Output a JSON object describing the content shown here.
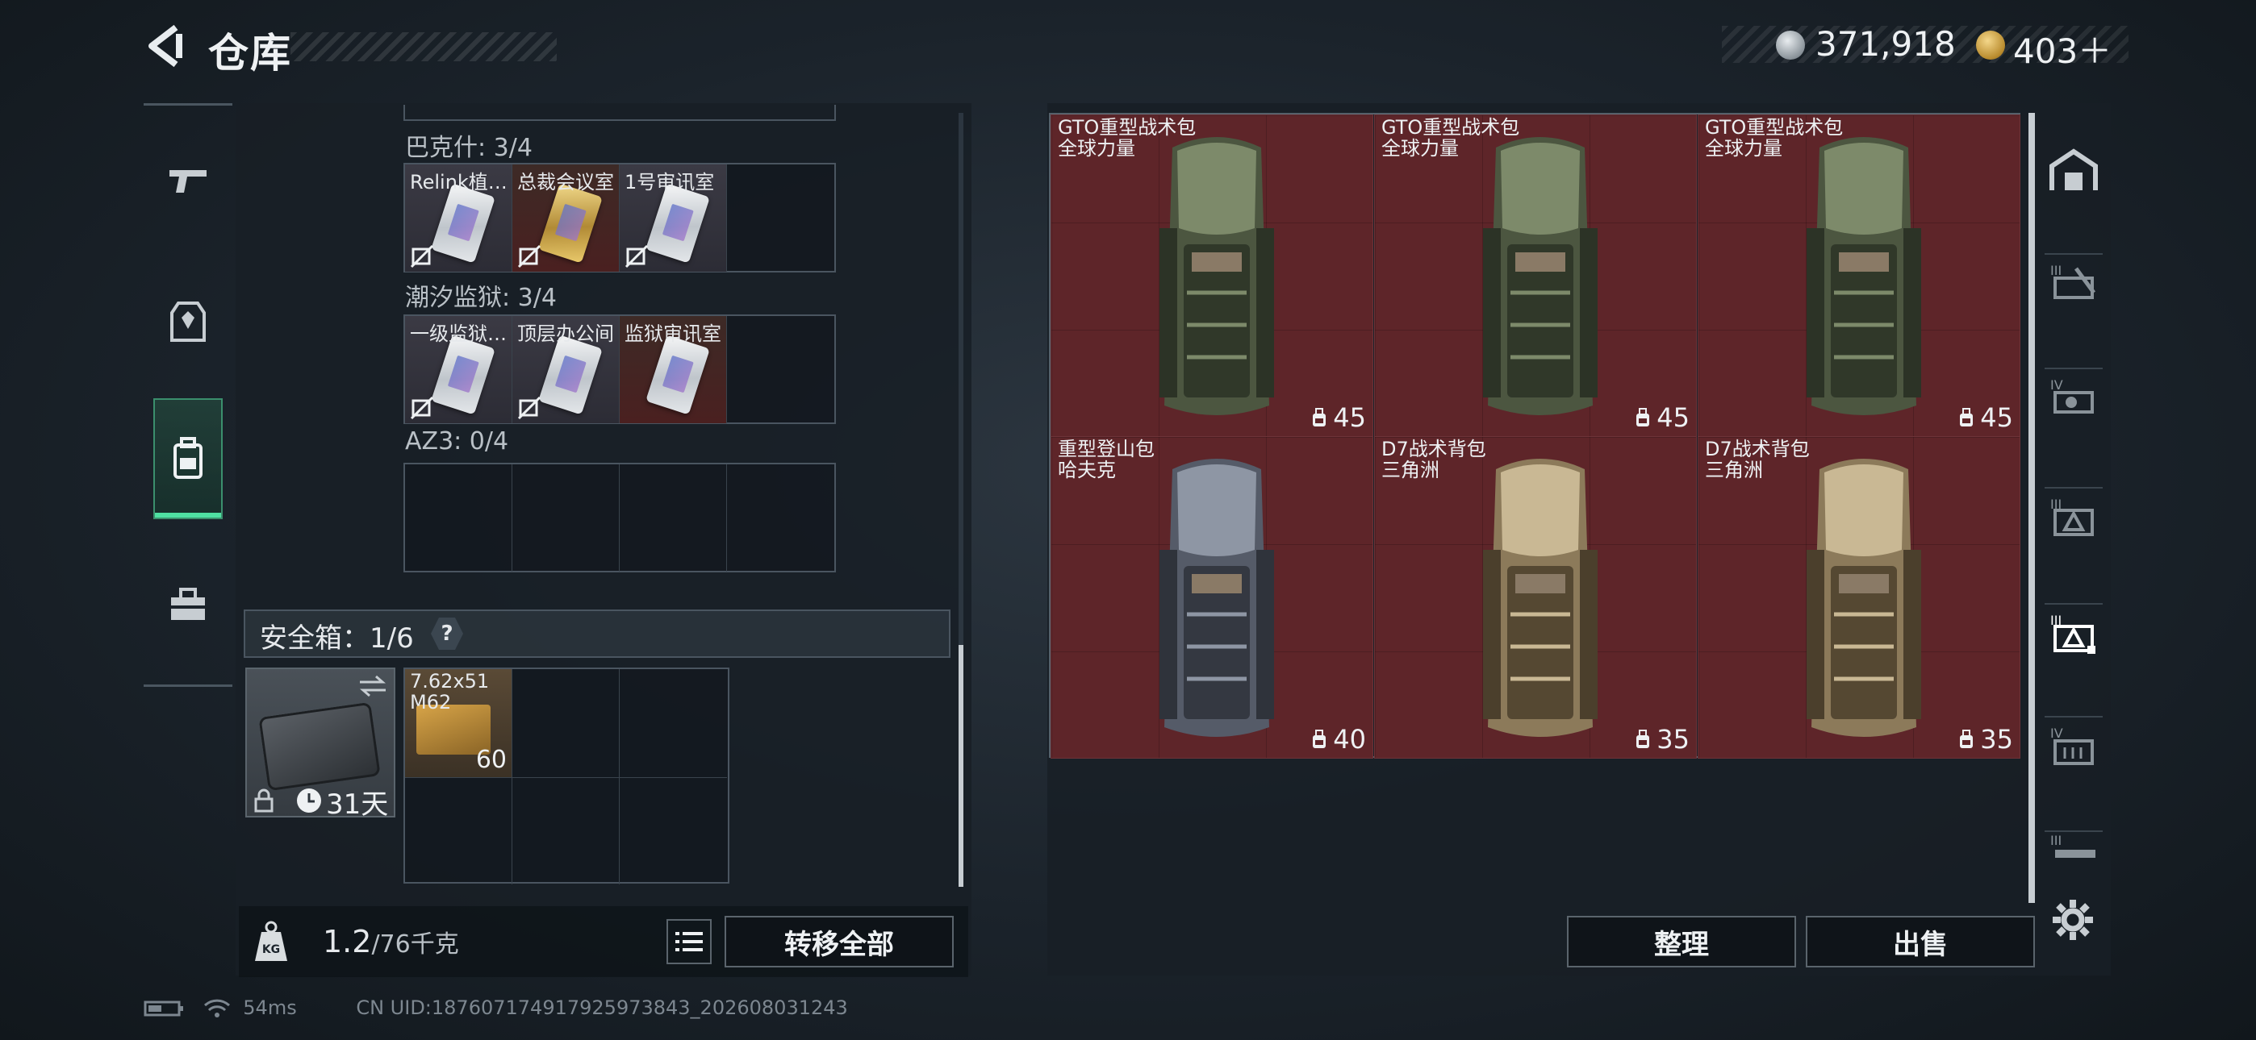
{
  "header": {
    "title": "仓库",
    "currency_silver": "371,918",
    "currency_gold": "403＋"
  },
  "left_nav": [
    "gun-icon",
    "armor-icon",
    "backpack-icon",
    "toolbox-icon"
  ],
  "keycard_sections": [
    {
      "label": "巴克什: 3/4",
      "cards": [
        {
          "name": "Relink植…",
          "style": "silver"
        },
        {
          "name": "总裁会议室",
          "style": "gold"
        },
        {
          "name": "1号审讯室",
          "style": "silver"
        }
      ]
    },
    {
      "label": "潮汐监狱: 3/4",
      "cards": [
        {
          "name": "一级监狱…",
          "style": "silver"
        },
        {
          "name": "顶层办公间",
          "style": "silver"
        },
        {
          "name": "监狱审讯室",
          "style": "silver"
        }
      ]
    },
    {
      "label": "AZ3: 0/4",
      "cards": []
    }
  ],
  "safebox": {
    "label": "安全箱：1/6",
    "help": "?",
    "duration": "31天",
    "ammo_name": "7.62x51\nM62",
    "ammo_count": "60"
  },
  "weight": {
    "current": "1.2",
    "max": "/76千克"
  },
  "buttons": {
    "transfer_all": "转移全部",
    "organize": "整理",
    "sell": "出售"
  },
  "stash_items": [
    {
      "line1": "GTO重型战术包",
      "line2": "全球力量",
      "capacity": "45",
      "color": "olive"
    },
    {
      "line1": "GTO重型战术包",
      "line2": "全球力量",
      "capacity": "45",
      "color": "olive"
    },
    {
      "line1": "GTO重型战术包",
      "line2": "全球力量",
      "capacity": "45",
      "color": "olive"
    },
    {
      "line1": "重型登山包",
      "line2": "哈夫克",
      "capacity": "40",
      "color": "grey"
    },
    {
      "line1": "D7战术背包",
      "line2": "三角洲",
      "capacity": "35",
      "color": "tan"
    },
    {
      "line1": "D7战术背包",
      "line2": "三角洲",
      "capacity": "35",
      "color": "tan"
    }
  ],
  "colors": {
    "item_bg": "#5e2529",
    "active_nav": "#4fe0a2"
  },
  "status": {
    "ping": "54ms",
    "uid": "CN UID:18760717491792597384​3_202608031243"
  }
}
